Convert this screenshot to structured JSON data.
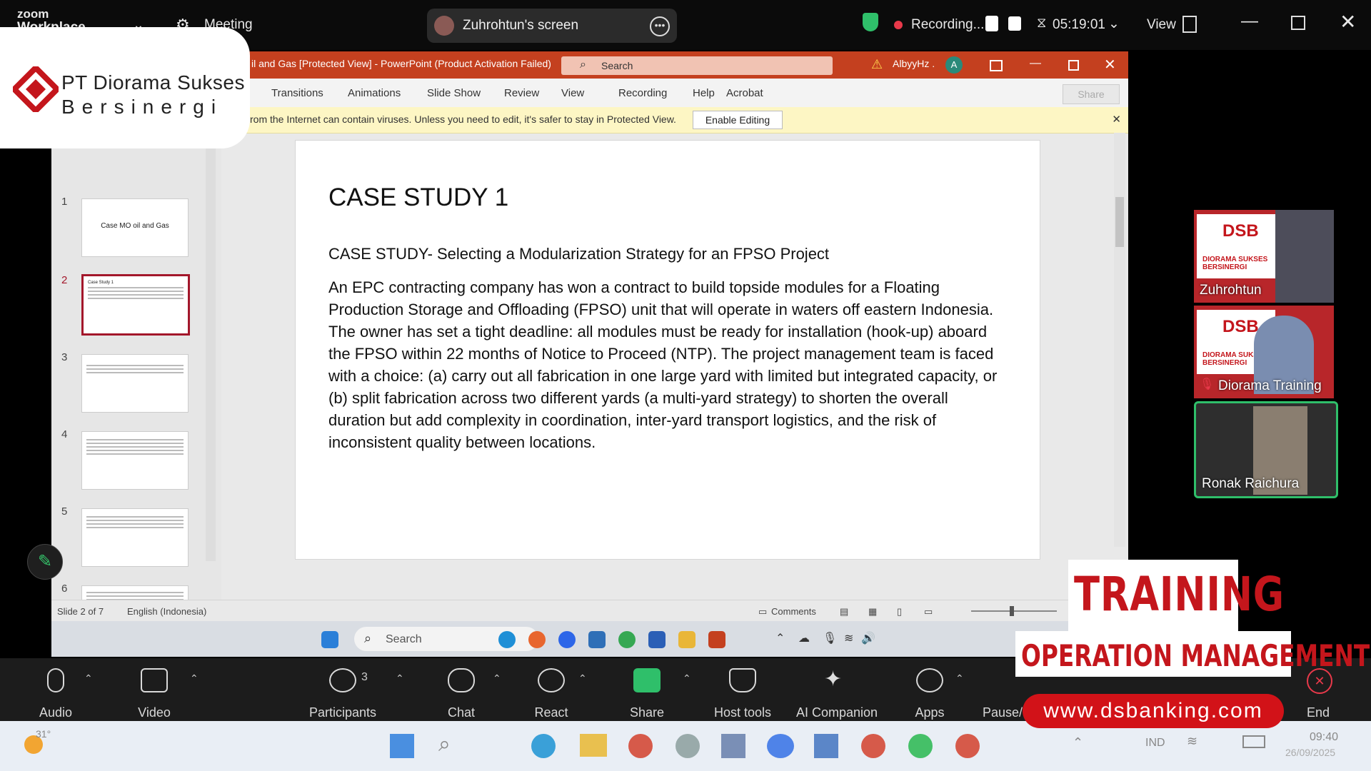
{
  "zoom_top": {
    "app_name_short": "zoom",
    "app_name_line2": "Workplace",
    "meeting_label": "Meeting",
    "screen_share_label": "Zuhrohtun's screen",
    "recording_label": "Recording...",
    "timer": "05:19:01",
    "view_label": "View"
  },
  "logo": {
    "company_line1": "PT Diorama  Sukses",
    "company_line2": "Bersinergi"
  },
  "ppt": {
    "title": "il and Gas [Protected View]  -  PowerPoint (Product Activation Failed)",
    "search_placeholder": "Search",
    "user_name": "AlbyyHz .",
    "user_initial": "A",
    "ribbon_tabs": [
      "Transitions",
      "Animations",
      "Slide Show",
      "Review",
      "View",
      "Recording",
      "Help",
      "Acrobat"
    ],
    "share_label": "Share",
    "protected_message": "rom the Internet can contain viruses. Unless you need to edit, it's safer to stay in Protected View.",
    "enable_editing_label": "Enable Editing",
    "thumbnails": [
      {
        "num": "1",
        "title": "Case MO oil and Gas"
      },
      {
        "num": "2",
        "title": "Case Study 1"
      },
      {
        "num": "3",
        "title": ""
      },
      {
        "num": "4",
        "title": ""
      },
      {
        "num": "5",
        "title": ""
      },
      {
        "num": "6",
        "title": ""
      }
    ],
    "slide": {
      "heading": "CASE STUDY 1",
      "subheading": "CASE STUDY- Selecting a Modularization Strategy for an FPSO Project",
      "body": "An EPC contracting company has won a contract to build topside modules for a Floating Production Storage and Offloading (FPSO) unit that will operate in waters off eastern Indonesia. The owner has set a tight deadline: all modules must be ready for installation (hook-up) aboard the FPSO within 22 months of Notice to Proceed (NTP). The project management team is faced with a choice: (a) carry out all fabrication in one large yard with limited but integrated capacity, or (b) split fabrication across two different yards (a multi-yard strategy) to shorten the overall duration but add complexity in coordination, inter-yard transport logistics, and the risk of inconsistent quality between locations."
    },
    "status": {
      "slide_counter": "Slide 2 of 7",
      "language": "English (Indonesia)",
      "comments_label": "Comments"
    }
  },
  "win_taskbar": {
    "search_placeholder": "Search"
  },
  "participants": [
    {
      "name": "Zuhrohtun",
      "logo_text": "DSB",
      "sub": "DIORAMA SUKSES BERSINERGI"
    },
    {
      "name": "Diorama Training",
      "logo_text": "DSB",
      "sub": "DIORAMA SUKSES BERSINERGI"
    },
    {
      "name": "Ronak Raichura"
    }
  ],
  "zoom_toolbar": {
    "audio": "Audio",
    "video": "Video",
    "participants": "Participants",
    "participants_count": "3",
    "chat": "Chat",
    "react": "React",
    "share": "Share",
    "host_tools": "Host tools",
    "ai_companion": "AI Companion",
    "apps": "Apps",
    "pause": "Pause/",
    "end": "End"
  },
  "os_taskbar": {
    "temperature": "31°",
    "language": "IND",
    "time": "09:40",
    "date": "26/09/2025"
  },
  "overlay": {
    "training": "TRAINING",
    "operation": "OPERATION MANAGEMENT",
    "url": "www.dsbanking.com"
  },
  "colors": {
    "ppt_accent": "#c4401f",
    "brand_red": "#c4161c",
    "active_speaker": "#2fbf6a"
  }
}
